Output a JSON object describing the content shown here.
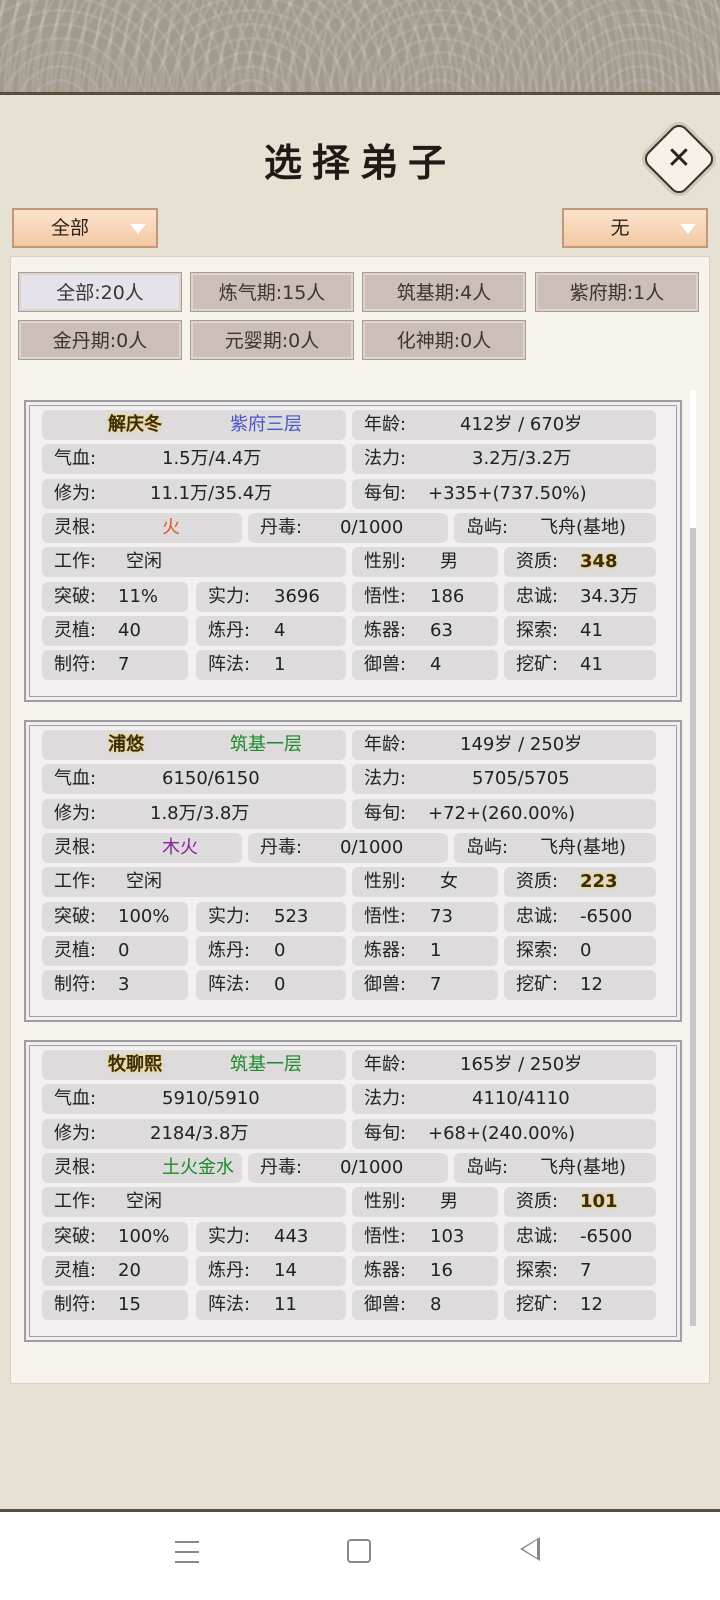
{
  "title": "选择弟子",
  "close_icon": "✕",
  "dropdown_left": "全部",
  "dropdown_right": "无",
  "filters": [
    "全部:20人",
    "炼气期:15人",
    "筑基期:4人",
    "紫府期:1人",
    "金丹期:0人",
    "元婴期:0人",
    "化神期:0人"
  ],
  "colors": {
    "realm_zifu": "#4a55c9",
    "realm_zhuji": "#1a8a2a",
    "root_fire": "#e0572a",
    "root_wood_fire": "#8a2398",
    "root_multi": "#1a8a2a"
  },
  "labels": {
    "age": "年龄:",
    "hp": "气血:",
    "mana": "法力:",
    "cultivation": "修为:",
    "per_turn": "每旬:",
    "root": "灵根:",
    "poison": "丹毒:",
    "island": "岛屿:",
    "work": "工作:",
    "gender": "性别:",
    "quality": "资质:",
    "breakthrough": "突破:",
    "strength": "实力:",
    "comprehension": "悟性:",
    "loyalty": "忠诚:",
    "plant": "灵植:",
    "alchemy": "炼丹:",
    "smith": "炼器:",
    "explore": "探索:",
    "talisman": "制符:",
    "formation": "阵法:",
    "beast": "御兽:",
    "mining": "挖矿:"
  },
  "disciples": [
    {
      "name": "解庆冬",
      "realm": "紫府三层",
      "realm_color": "#4a55c9",
      "age": "412岁 / 670岁",
      "hp": "1.5万/4.4万",
      "mana": "3.2万/3.2万",
      "cultivation": "11.1万/35.4万",
      "per_turn": "+335+(737.50%)",
      "root": "火",
      "root_color": "#e0572a",
      "poison": "0/1000",
      "island": "飞舟(基地)",
      "work": "空闲",
      "gender": "男",
      "quality": "348",
      "breakthrough": "11%",
      "strength": "3696",
      "comprehension": "186",
      "loyalty": "34.3万",
      "plant": "40",
      "alchemy": "4",
      "smith": "63",
      "explore": "41",
      "talisman": "7",
      "formation": "1",
      "beast": "4",
      "mining": "41"
    },
    {
      "name": "浦悠",
      "realm": "筑基一层",
      "realm_color": "#1a8a2a",
      "age": "149岁 / 250岁",
      "hp": "6150/6150",
      "mana": "5705/5705",
      "cultivation": "1.8万/3.8万",
      "per_turn": "+72+(260.00%)",
      "root": "木火",
      "root_color": "#8a2398",
      "poison": "0/1000",
      "island": "飞舟(基地)",
      "work": "空闲",
      "gender": "女",
      "quality": "223",
      "breakthrough": "100%",
      "strength": "523",
      "comprehension": "73",
      "loyalty": "-6500",
      "plant": "0",
      "alchemy": "0",
      "smith": "1",
      "explore": "0",
      "talisman": "3",
      "formation": "0",
      "beast": "7",
      "mining": "12"
    },
    {
      "name": "牧聊熙",
      "realm": "筑基一层",
      "realm_color": "#1a8a2a",
      "age": "165岁 / 250岁",
      "hp": "5910/5910",
      "mana": "4110/4110",
      "cultivation": "2184/3.8万",
      "per_turn": "+68+(240.00%)",
      "root": "土火金水",
      "root_color": "#1a8a2a",
      "poison": "0/1000",
      "island": "飞舟(基地)",
      "work": "空闲",
      "gender": "男",
      "quality": "101",
      "breakthrough": "100%",
      "strength": "443",
      "comprehension": "103",
      "loyalty": "-6500",
      "plant": "20",
      "alchemy": "14",
      "smith": "16",
      "explore": "7",
      "talisman": "15",
      "formation": "11",
      "beast": "8",
      "mining": "12"
    }
  ],
  "nav": {
    "menu_icon": "menu-icon",
    "home_icon": "home-icon",
    "back_icon": "back-icon"
  }
}
